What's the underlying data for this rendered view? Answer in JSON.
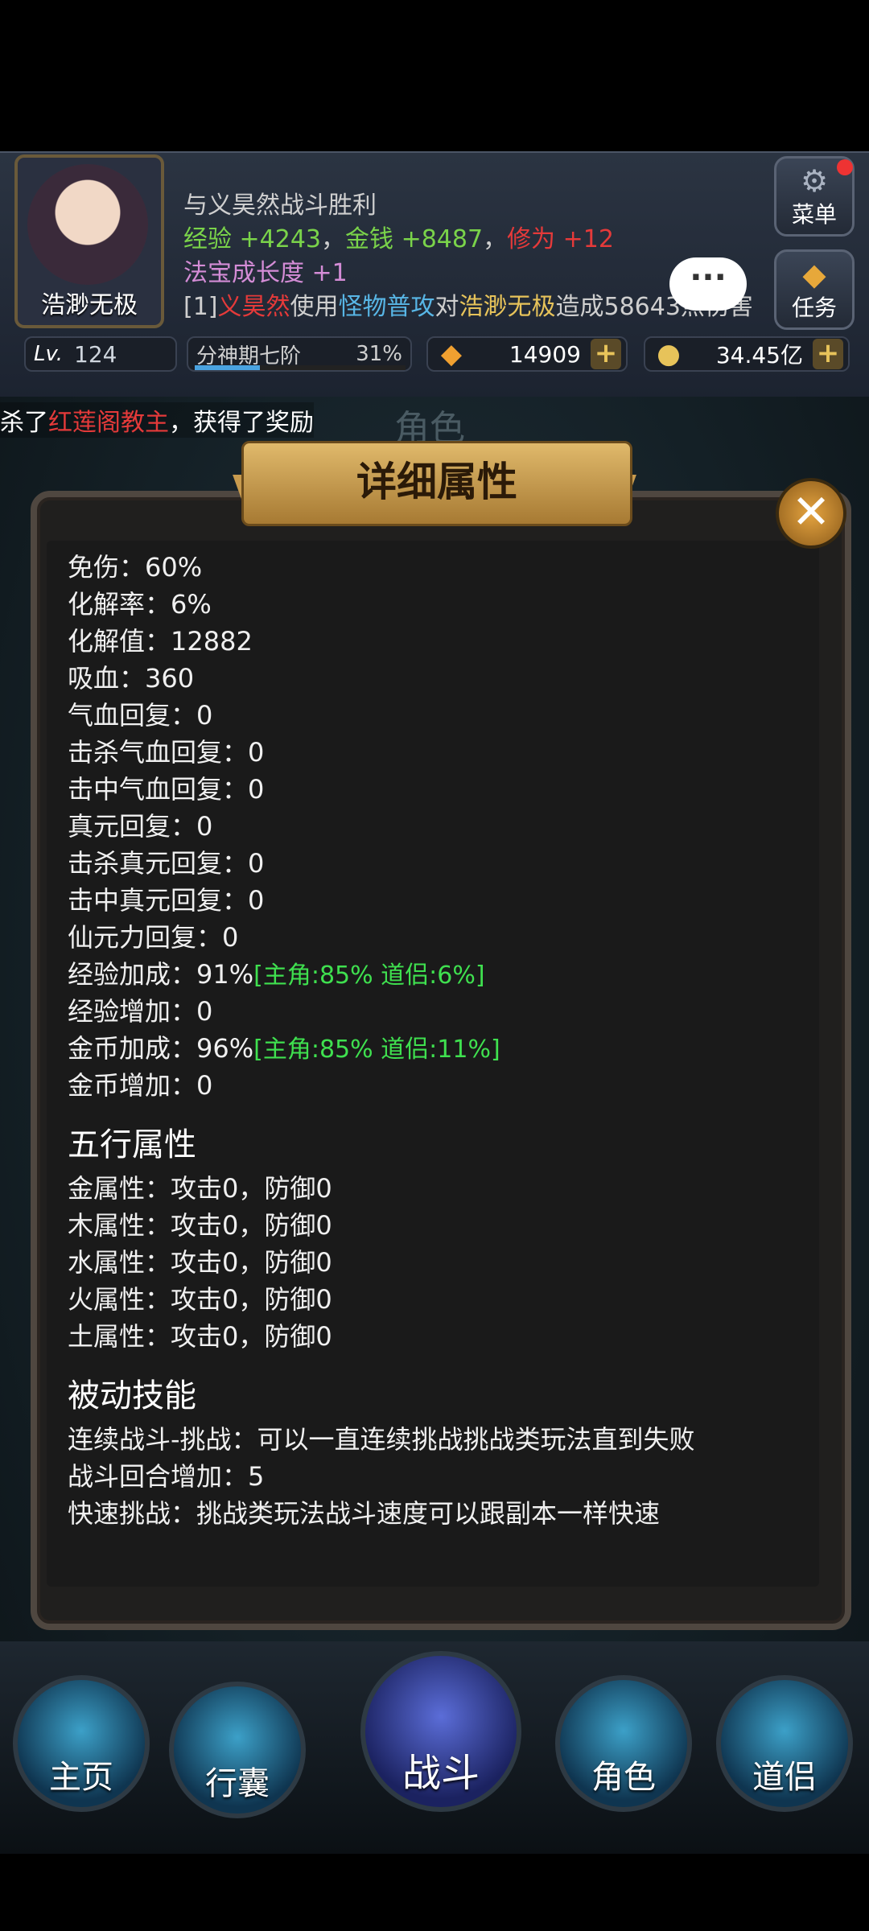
{
  "player": {
    "name": "浩渺无极"
  },
  "battle_log": {
    "line1": "与义昊然战斗胜利",
    "exp_label": "经验 +4243",
    "sep1": "，",
    "money_label": "金钱 +8487",
    "sep2": "，",
    "cult_label": "修为 +12",
    "treasure": "法宝成长度 +1",
    "l4_prefix": "[1]",
    "l4_name": "义昊然",
    "l4_use": "使用",
    "l4_skill": "怪物普攻",
    "l4_to": "对",
    "l4_target": "浩渺无极",
    "l4_rest": "造成58643点伤害"
  },
  "side": {
    "menu_label": "菜单",
    "task_label": "任务"
  },
  "status": {
    "lv_label": "Lv.",
    "level": "124",
    "realm": "分神期七阶",
    "realm_pct": "31%",
    "realm_progress": 0.31,
    "gems": "14909",
    "gold": "34.45亿",
    "plus": "+"
  },
  "notice": {
    "prefix": "杀了",
    "boss": "红莲阁教主",
    "suffix": "，获得了奖励"
  },
  "bg_title": "角色",
  "panel": {
    "title": "详细属性",
    "close": "✕",
    "attributes": [
      {
        "text": "免伤：60%",
        "bonus": ""
      },
      {
        "text": "化解率：6%",
        "bonus": ""
      },
      {
        "text": "化解值：12882",
        "bonus": ""
      },
      {
        "text": "吸血：360",
        "bonus": ""
      },
      {
        "text": "气血回复：0",
        "bonus": ""
      },
      {
        "text": "击杀气血回复：0",
        "bonus": ""
      },
      {
        "text": "击中气血回复：0",
        "bonus": ""
      },
      {
        "text": "真元回复：0",
        "bonus": ""
      },
      {
        "text": "击杀真元回复：0",
        "bonus": ""
      },
      {
        "text": "击中真元回复：0",
        "bonus": ""
      },
      {
        "text": "仙元力回复：0",
        "bonus": ""
      },
      {
        "text": "经验加成：91%",
        "bonus": "[主角:85% 道侣:6%]"
      },
      {
        "text": "经验增加：0",
        "bonus": ""
      },
      {
        "text": "金币加成：96%",
        "bonus": "[主角:85% 道侣:11%]"
      },
      {
        "text": "金币增加：0",
        "bonus": ""
      }
    ],
    "elements_heading": "五行属性",
    "elements": [
      "金属性：攻击0，防御0",
      "木属性：攻击0，防御0",
      "水属性：攻击0，防御0",
      "火属性：攻击0，防御0",
      "土属性：攻击0，防御0"
    ],
    "passive_heading": "被动技能",
    "passives": [
      "连续战斗-挑战：可以一直连续挑战挑战类玩法直到失败",
      "战斗回合增加：5",
      "快速挑战：挑战类玩法战斗速度可以跟副本一样快速"
    ]
  },
  "nav": {
    "home": "主页",
    "bag": "行囊",
    "battle": "战斗",
    "role": "角色",
    "partner": "道侣"
  },
  "colors": {
    "bonus_green": "#3fe04f",
    "banner_gold": "#e0b96b",
    "boss_red": "#e53a3a"
  }
}
